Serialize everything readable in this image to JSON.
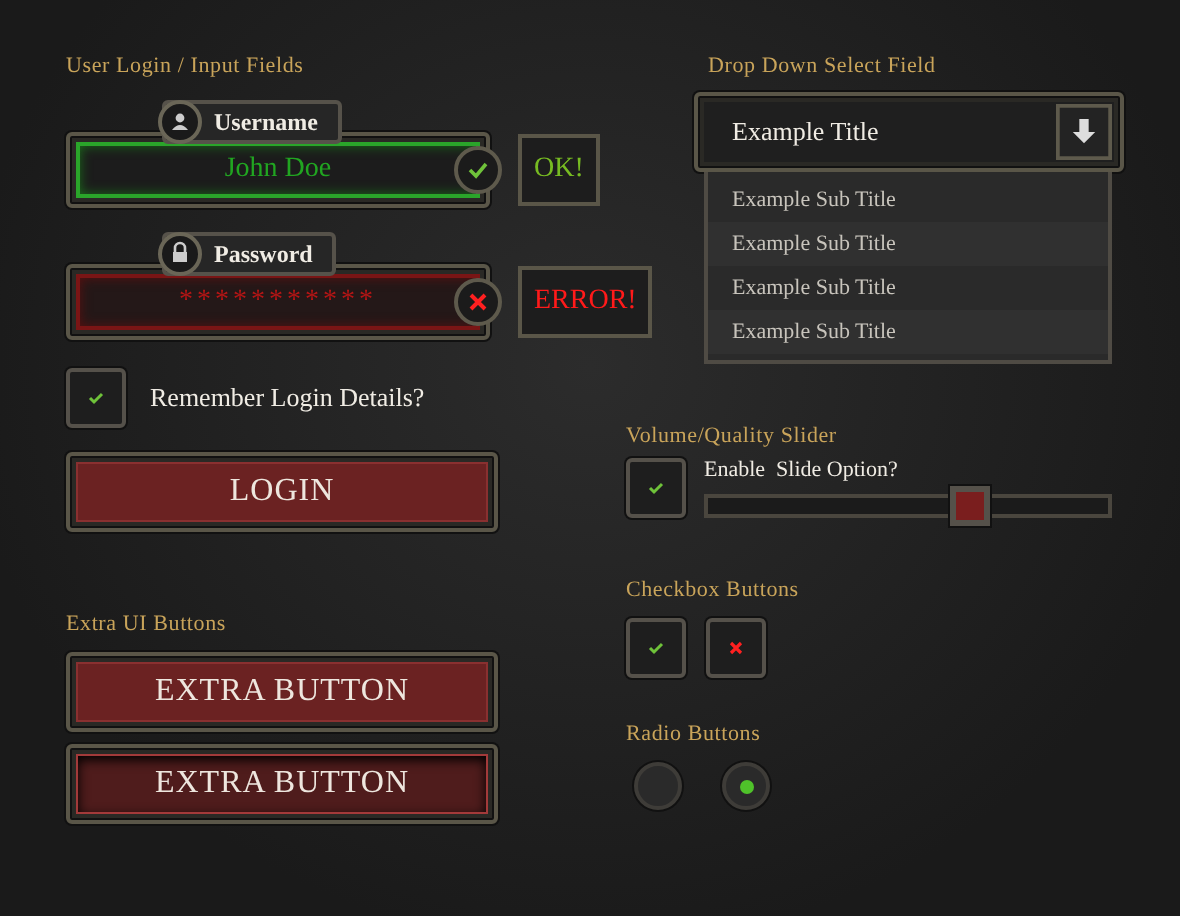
{
  "login": {
    "heading": "User Login / Input Fields",
    "fields": [
      {
        "kind": "text",
        "label": "Username",
        "value": "John Doe",
        "valid": true,
        "message": "OK!"
      },
      {
        "kind": "password",
        "label": "Password",
        "value": "***********",
        "valid": false,
        "message": "ERROR!"
      }
    ],
    "remember": {
      "label": "Remember Login Details?",
      "checked": true
    },
    "button": "LOGIN"
  },
  "extra": {
    "heading": "Extra UI Buttons",
    "buttons": [
      {
        "label": "EXTRA BUTTON",
        "pressed": false
      },
      {
        "label": "EXTRA BUTTON",
        "pressed": true
      }
    ]
  },
  "dropdown": {
    "heading": "Drop Down Select Field",
    "value": "Example Title",
    "options": [
      "Example Sub Title",
      "Example Sub Title",
      "Example Sub Title",
      "Example Sub Title"
    ]
  },
  "slider": {
    "heading": "Volume/Quality Slider",
    "label": "Enable  Slide Option?",
    "checked": true,
    "level": 0.65
  },
  "checkboxes": {
    "heading": "Checkbox Buttons",
    "items": [
      {
        "kind": "tick"
      },
      {
        "kind": "cross"
      }
    ]
  },
  "radios": {
    "heading": "Radio Buttons",
    "items": [
      {
        "selected": false
      },
      {
        "selected": true
      }
    ]
  }
}
